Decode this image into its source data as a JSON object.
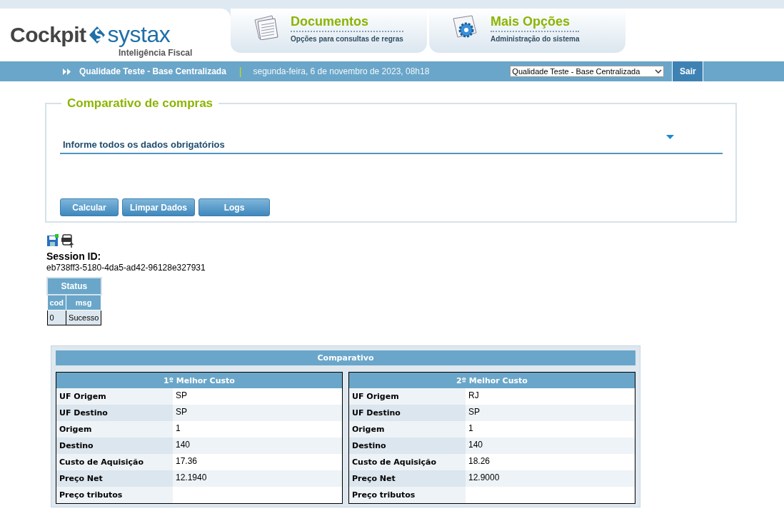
{
  "logo": {
    "left": "Cockpit",
    "right": "systax",
    "tagline": "Inteligência Fiscal"
  },
  "menus": [
    {
      "kind": "documents",
      "title": "Documentos",
      "subtitle": "Opções para consultas de regras"
    },
    {
      "kind": "admin",
      "title": "Mais Opções",
      "subtitle": "Administração do sistema"
    }
  ],
  "nav": {
    "base": "Qualidade Teste - Base Centralizada",
    "separator": "|",
    "date": "segunda-feira, 6 de novembro de 2023, 08h18",
    "select_value": "Qualidade Teste - Base Centralizada",
    "logout": "Sair"
  },
  "form": {
    "legend": "Comparativo de compras",
    "section_title": "Informe todos os dados obrigatórios",
    "buttons": [
      "Calcular",
      "Limpar Dados",
      "Logs"
    ]
  },
  "session": {
    "label": "Session ID:",
    "id": "eb738ff3-5180-4da5-ad42-96128e327931"
  },
  "status_table": {
    "title": "Status",
    "columns": [
      "cod",
      "msg"
    ],
    "rows": [
      [
        "0",
        "Sucesso"
      ]
    ]
  },
  "comparison": {
    "title": "Comparativo",
    "panels": [
      {
        "title": "1º  Melhor Custo",
        "rows": [
          {
            "label": "UF Origem",
            "value": "SP"
          },
          {
            "label": "UF Destino",
            "value": "SP"
          },
          {
            "label": "Origem",
            "value": "1"
          },
          {
            "label": "Destino",
            "value": "140"
          },
          {
            "label": "Custo de Aquisição",
            "value": "17.36"
          },
          {
            "label": "Preço Net",
            "value": "12.1940"
          },
          {
            "label": "Preço tributos"
          }
        ]
      },
      {
        "title": "2º  Melhor Custo",
        "rows": [
          {
            "label": "UF Origem",
            "value": "RJ"
          },
          {
            "label": "UF Destino",
            "value": "SP"
          },
          {
            "label": "Origem",
            "value": "1"
          },
          {
            "label": "Destino",
            "value": "140"
          },
          {
            "label": "Custo de Aquisição",
            "value": "18.26"
          },
          {
            "label": "Preço Net",
            "value": "12.9000"
          },
          {
            "label": "Preço tributos"
          }
        ]
      }
    ]
  }
}
